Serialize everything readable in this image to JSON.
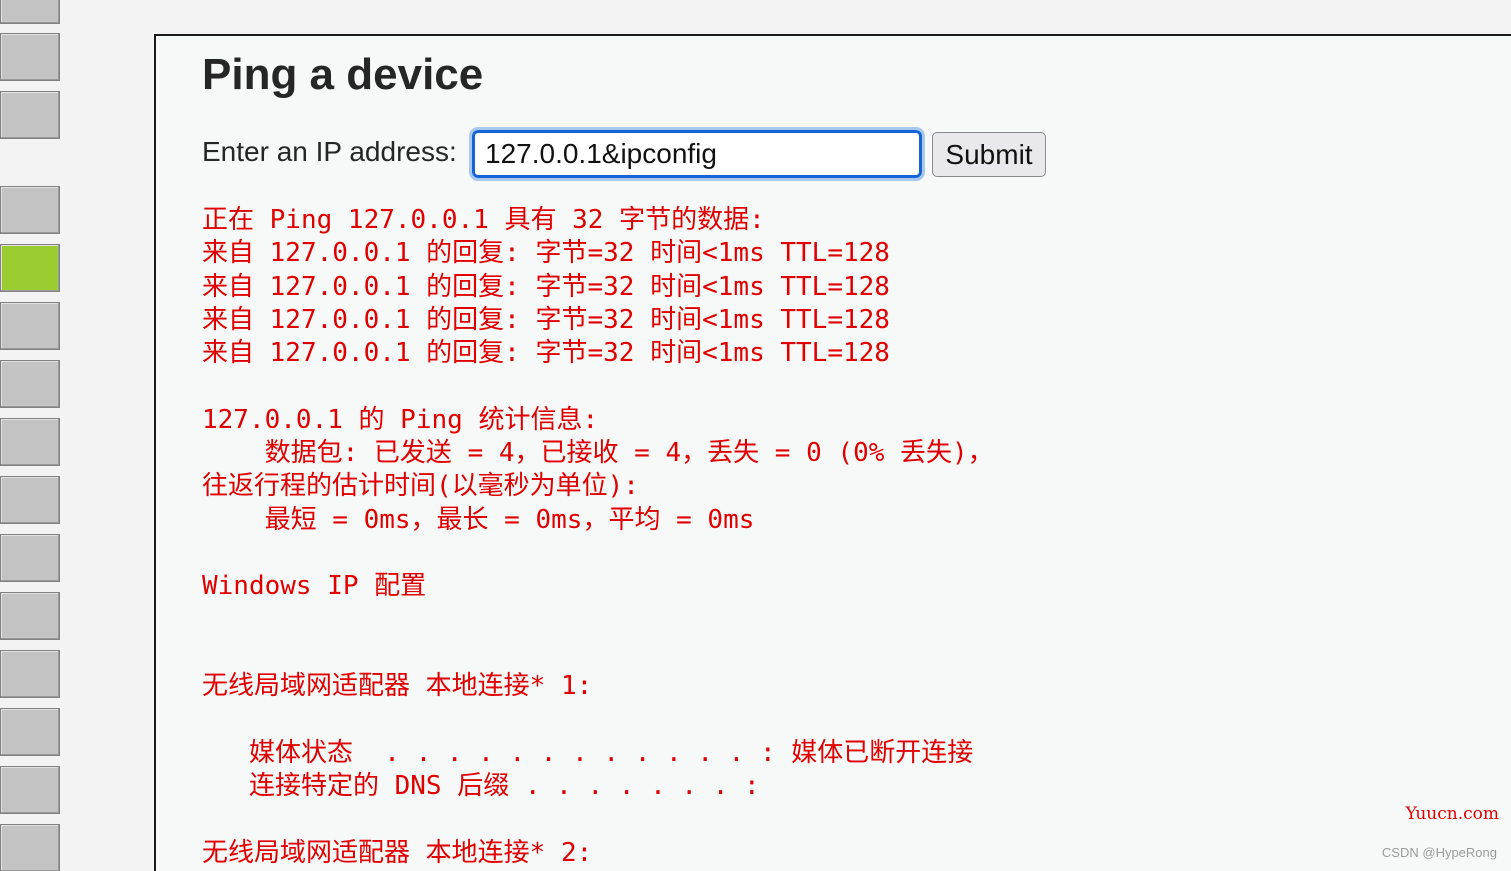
{
  "colors": {
    "menu_block": "#c3c3c3",
    "menu_active": "#9acd32",
    "output_text": "#e00000",
    "input_border": "#1565d8"
  },
  "page": {
    "title": "Ping a device",
    "ip_label": "Enter an IP address:",
    "ip_value": "127.0.0.1&ipconfig",
    "submit_label": "Submit"
  },
  "output_lines": [
    "正在 Ping 127.0.0.1 具有 32 字节的数据:",
    "来自 127.0.0.1 的回复: 字节=32 时间<1ms TTL=128",
    "来自 127.0.0.1 的回复: 字节=32 时间<1ms TTL=128",
    "来自 127.0.0.1 的回复: 字节=32 时间<1ms TTL=128",
    "来自 127.0.0.1 的回复: 字节=32 时间<1ms TTL=128",
    "",
    "127.0.0.1 的 Ping 统计信息:",
    "    数据包: 已发送 = 4，已接收 = 4，丢失 = 0 (0% 丢失)，",
    "往返行程的估计时间(以毫秒为单位):",
    "    最短 = 0ms，最长 = 0ms，平均 = 0ms",
    "",
    "Windows IP 配置",
    "",
    "",
    "无线局域网适配器 本地连接* 1:",
    "",
    "   媒体状态  . . . . . . . . . . . . : 媒体已断开连接",
    "   连接特定的 DNS 后缀 . . . . . . . :",
    "",
    "无线局域网适配器 本地连接* 2:"
  ],
  "watermarks": {
    "site": "Yuucn.com",
    "author": "CSDN @HypeRong"
  }
}
